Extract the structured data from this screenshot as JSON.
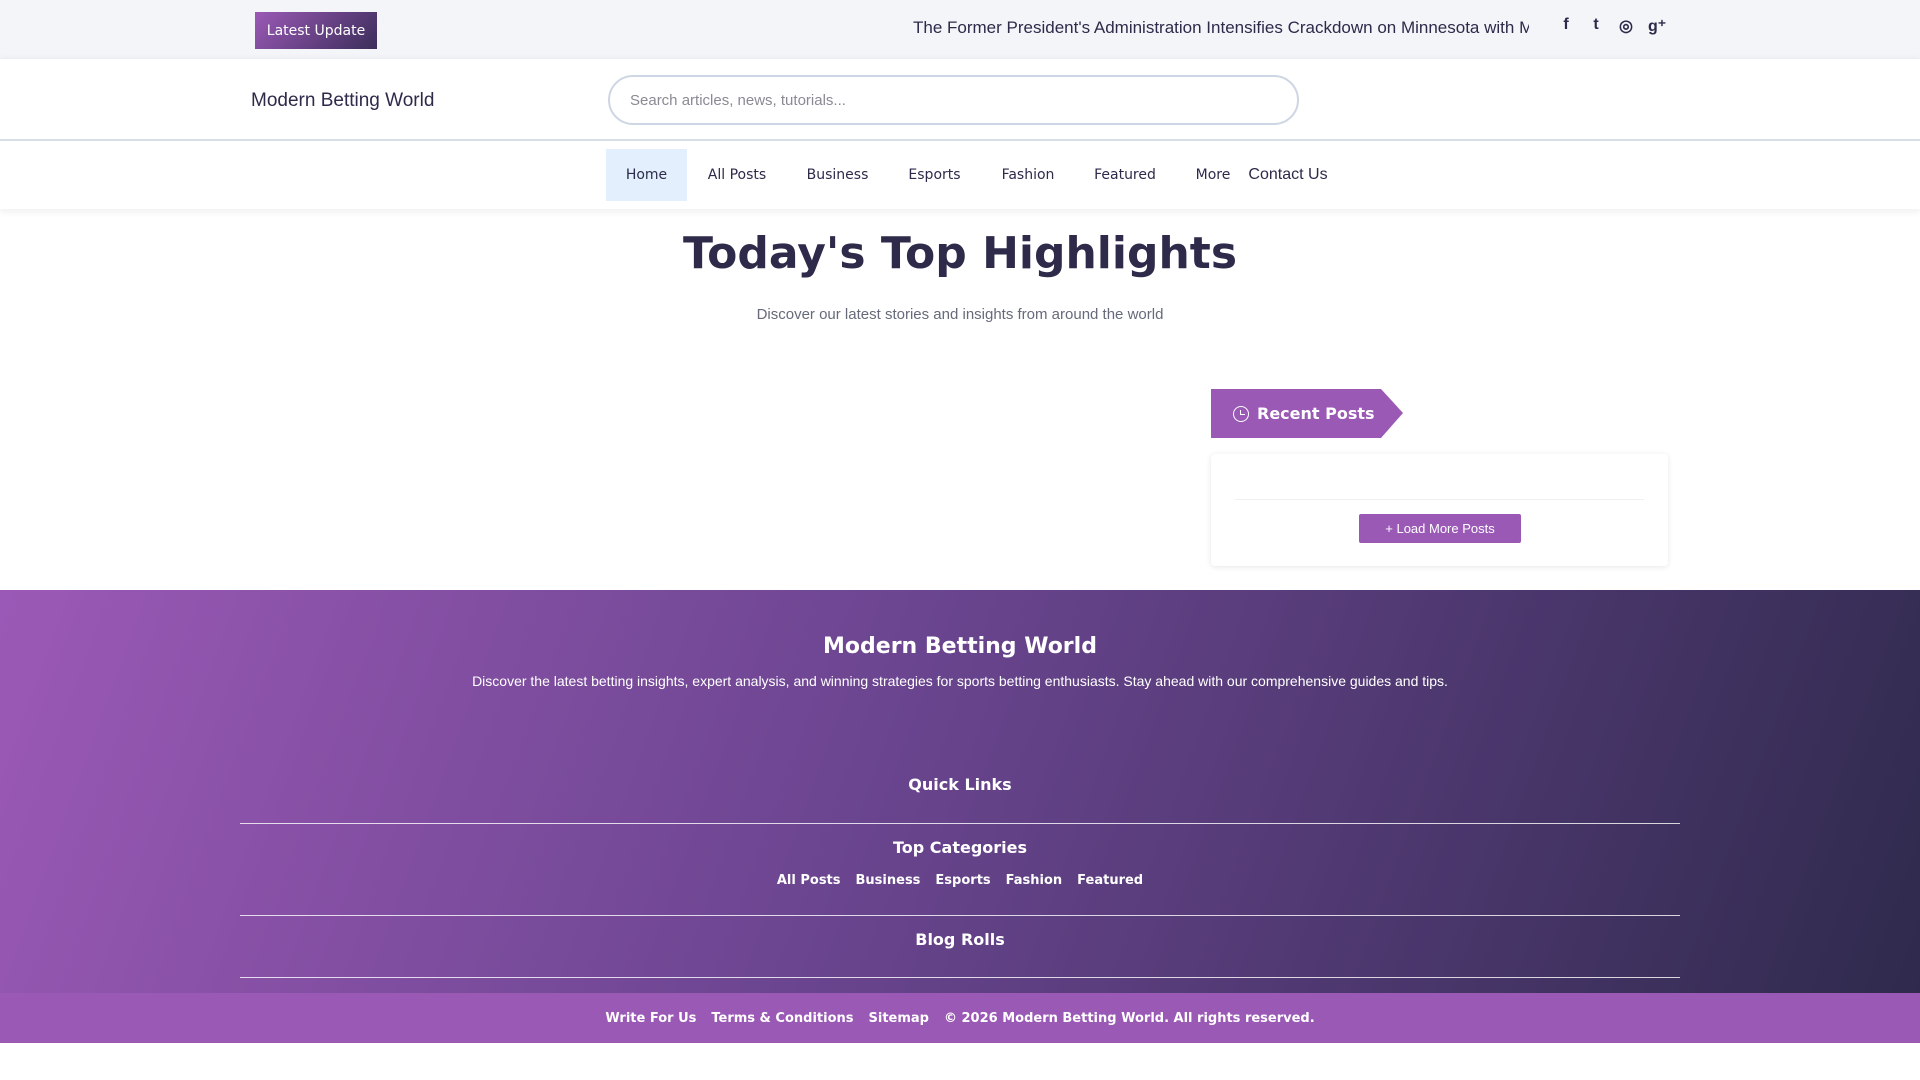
{
  "topbar": {
    "latest_label": "Latest Update",
    "ticker": "The Former President's Administration Intensifies Crackdown on Minnesota with More I",
    "social": [
      "facebook-icon",
      "twitter-icon",
      "instagram-icon",
      "google-plus-icon"
    ]
  },
  "header": {
    "logo": "Modern Betting World",
    "search_placeholder": "Search articles, news, tutorials..."
  },
  "nav": {
    "items": [
      "Home",
      "All Posts",
      "Business",
      "Esports",
      "Fashion",
      "Featured",
      "More",
      "Contact Us"
    ]
  },
  "hero": {
    "title": "Today's Top Highlights",
    "subtitle": "Discover our latest stories and insights from around the world"
  },
  "sidebar": {
    "title": "Recent Posts",
    "load_more": "Load More Posts"
  },
  "footer": {
    "title": "Modern Betting World",
    "description": "Discover the latest betting insights, expert analysis, and winning strategies for sports betting enthusiasts. Stay ahead with our comprehensive guides and tips.",
    "quick_links": "Quick Links",
    "top_categories": "Top Categories",
    "categories": [
      "All Posts",
      "Business",
      "Esports",
      "Fashion",
      "Featured"
    ],
    "blog_rolls": "Blog Rolls"
  },
  "bottom": {
    "links": [
      "Write For Us",
      "Terms & Conditions",
      "Sitemap"
    ],
    "copyright": "© 2026 Modern Betting World. All rights reserved."
  },
  "colors": {
    "accent": "#9b59b6",
    "text": "#2d2a4a"
  }
}
